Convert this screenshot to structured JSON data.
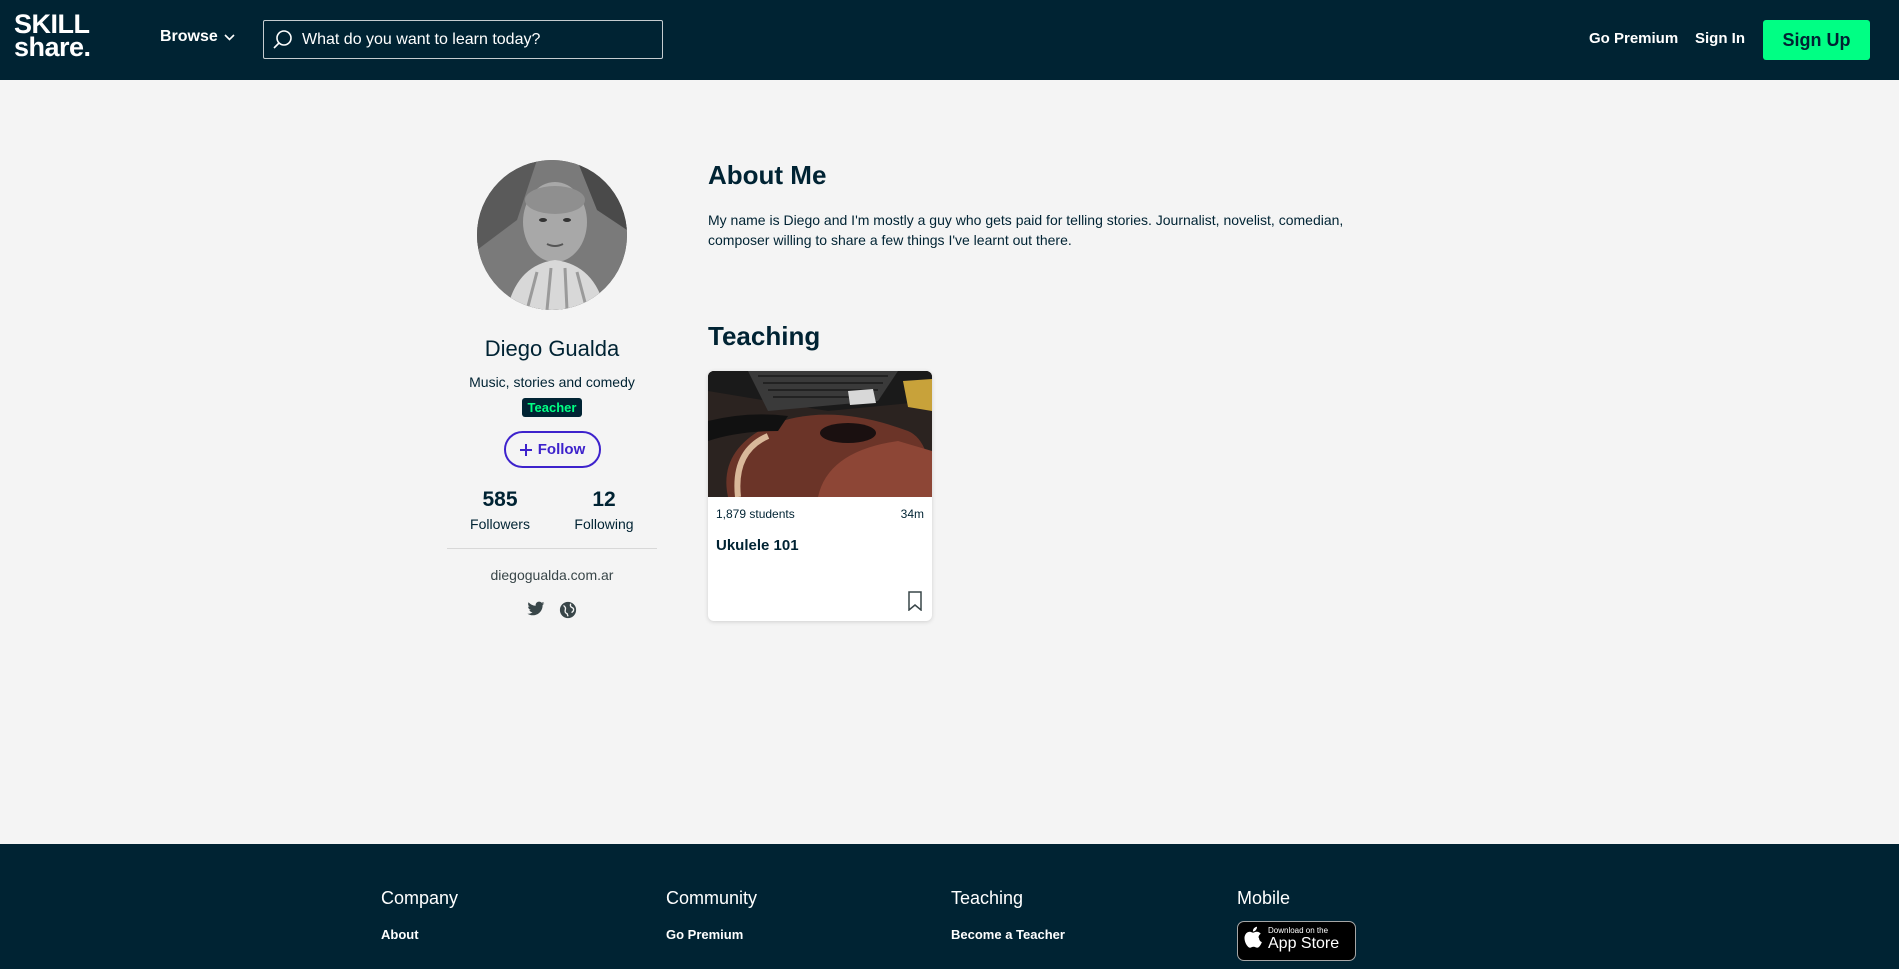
{
  "header": {
    "logo_line1": "SKILL",
    "logo_line2": "share.",
    "browse_label": "Browse",
    "search_placeholder": "What do you want to learn today?",
    "go_premium_label": "Go Premium",
    "sign_in_label": "Sign In",
    "sign_up_label": "Sign Up"
  },
  "profile": {
    "name": "Diego Gualda",
    "headline": "Music, stories and comedy",
    "badge": "Teacher",
    "follow_label": "Follow",
    "followers_count": "585",
    "followers_label": "Followers",
    "following_count": "12",
    "following_label": "Following",
    "website": "diegogualda.com.ar",
    "social_icons": [
      "twitter-icon",
      "globe-icon"
    ]
  },
  "about": {
    "title": "About Me",
    "text": "My name is Diego and I'm mostly a guy who gets paid for telling stories. Journalist, novelist, comedian, composer willing to share a few things I've learnt out there."
  },
  "teaching": {
    "title": "Teaching",
    "classes": [
      {
        "students": "1,879 students",
        "duration": "34m",
        "title": "Ukulele 101"
      }
    ]
  },
  "footer": {
    "columns": [
      {
        "title": "Company",
        "first_link": "About"
      },
      {
        "title": "Community",
        "first_link": "Go Premium"
      },
      {
        "title": "Teaching",
        "first_link": "Become a Teacher"
      },
      {
        "title": "Mobile",
        "appstore_small": "Download on the",
        "appstore_big": "App Store"
      }
    ]
  },
  "colors": {
    "navy": "#002333",
    "accent_green": "#00ff84",
    "follow_purple": "#3d22cc",
    "page_bg": "#f4f4f4"
  }
}
